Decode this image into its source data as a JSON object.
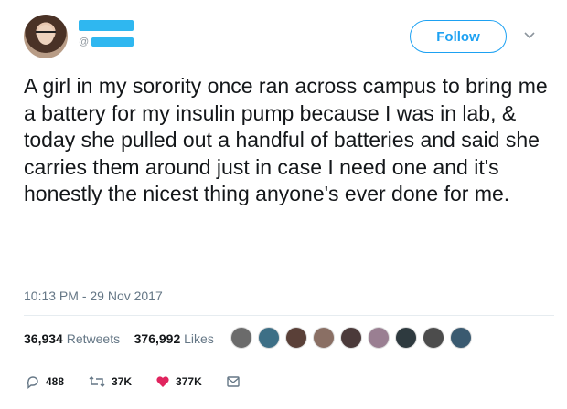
{
  "tweet": {
    "follow_label": "Follow",
    "handle_prefix": "@",
    "text": "A girl in my sorority once ran across campus to bring me a battery for my insulin pump because I was in lab, & today she pulled out a handful of batteries and said she carries them around just in case I need one and it's honestly the nicest thing anyone's ever done for me.",
    "timestamp": "10:13 PM - 29 Nov 2017",
    "retweets_count": "36,934",
    "retweets_label": "Retweets",
    "likes_count": "376,992",
    "likes_label": "Likes",
    "liker_avatar_colors": [
      "#6b6b6b",
      "#3d6f86",
      "#5a4038",
      "#8a6f64",
      "#4b3a3a",
      "#9a7f92",
      "#2e3a3f",
      "#4c4c4c",
      "#3a5a70"
    ]
  },
  "actions": {
    "reply_count": "488",
    "retweet_count": "37K",
    "like_count": "377K"
  },
  "colors": {
    "accent": "#1da1f2",
    "like": "#e0245e",
    "secondary_text": "#657786",
    "redaction": "#2fb7f0"
  }
}
